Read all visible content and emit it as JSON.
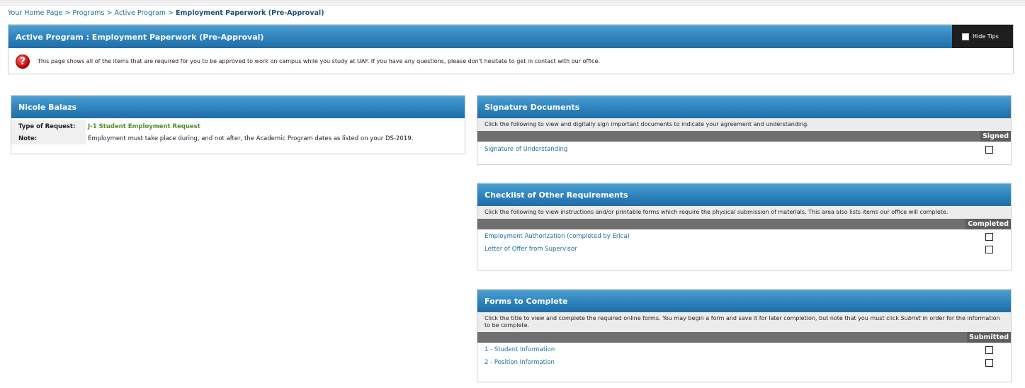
{
  "breadcrumb": {
    "items": [
      "Your Home Page",
      "Programs",
      "Active Program"
    ],
    "current": "Employment Paperwork (Pre-Approval)",
    "separator": ">"
  },
  "active_program": {
    "title": "Active Program : Employment Paperwork (Pre-Approval)",
    "hide_tips_label": "Hide Tips",
    "tip_icon": "question-icon",
    "tip_text": "This page shows all of the items that are required for you to be approved to work on campus while you study at UAF. If you have any questions, please don't hesitate to get in contact with our office."
  },
  "person": {
    "name": "Nicole Balazs",
    "rows": [
      {
        "label": "Type of Request:",
        "value": "J-1 Student Employment Request"
      },
      {
        "label": "Note:",
        "value": "Employment must take place during, and not after, the Academic Program dates as listed on your DS-2019."
      }
    ]
  },
  "signature_documents": {
    "title": "Signature Documents",
    "description": "Click the following to view and digitally sign important documents to indicate your agreement and understanding.",
    "column": "Signed",
    "items": [
      {
        "label": "Signature of Understanding",
        "checked": false
      }
    ]
  },
  "checklist": {
    "title": "Checklist of Other Requirements",
    "description": "Click the following to view instructions and/or printable forms which require the physical submission of materials. This area also lists items our office will complete.",
    "column": "Completed",
    "items": [
      {
        "label": "Employment Authorization (completed by Erica)",
        "checked": false
      },
      {
        "label": "Letter of Offer from Supervisor",
        "checked": false
      }
    ]
  },
  "forms": {
    "title": "Forms to Complete",
    "description_pre": "Click the title to view and complete the required online forms. You may begin a form and save it for later completion, but note that you must click ",
    "description_em": "Submit",
    "description_post": " in order for the information to be complete.",
    "column": "Submitted",
    "items": [
      {
        "label": "1 - Student Information",
        "checked": false
      },
      {
        "label": "2 - Position Information",
        "checked": false
      }
    ]
  },
  "colors": {
    "header_blue": "#3287c0",
    "link": "#1c6f9a",
    "value_green": "#5a8a2a"
  }
}
